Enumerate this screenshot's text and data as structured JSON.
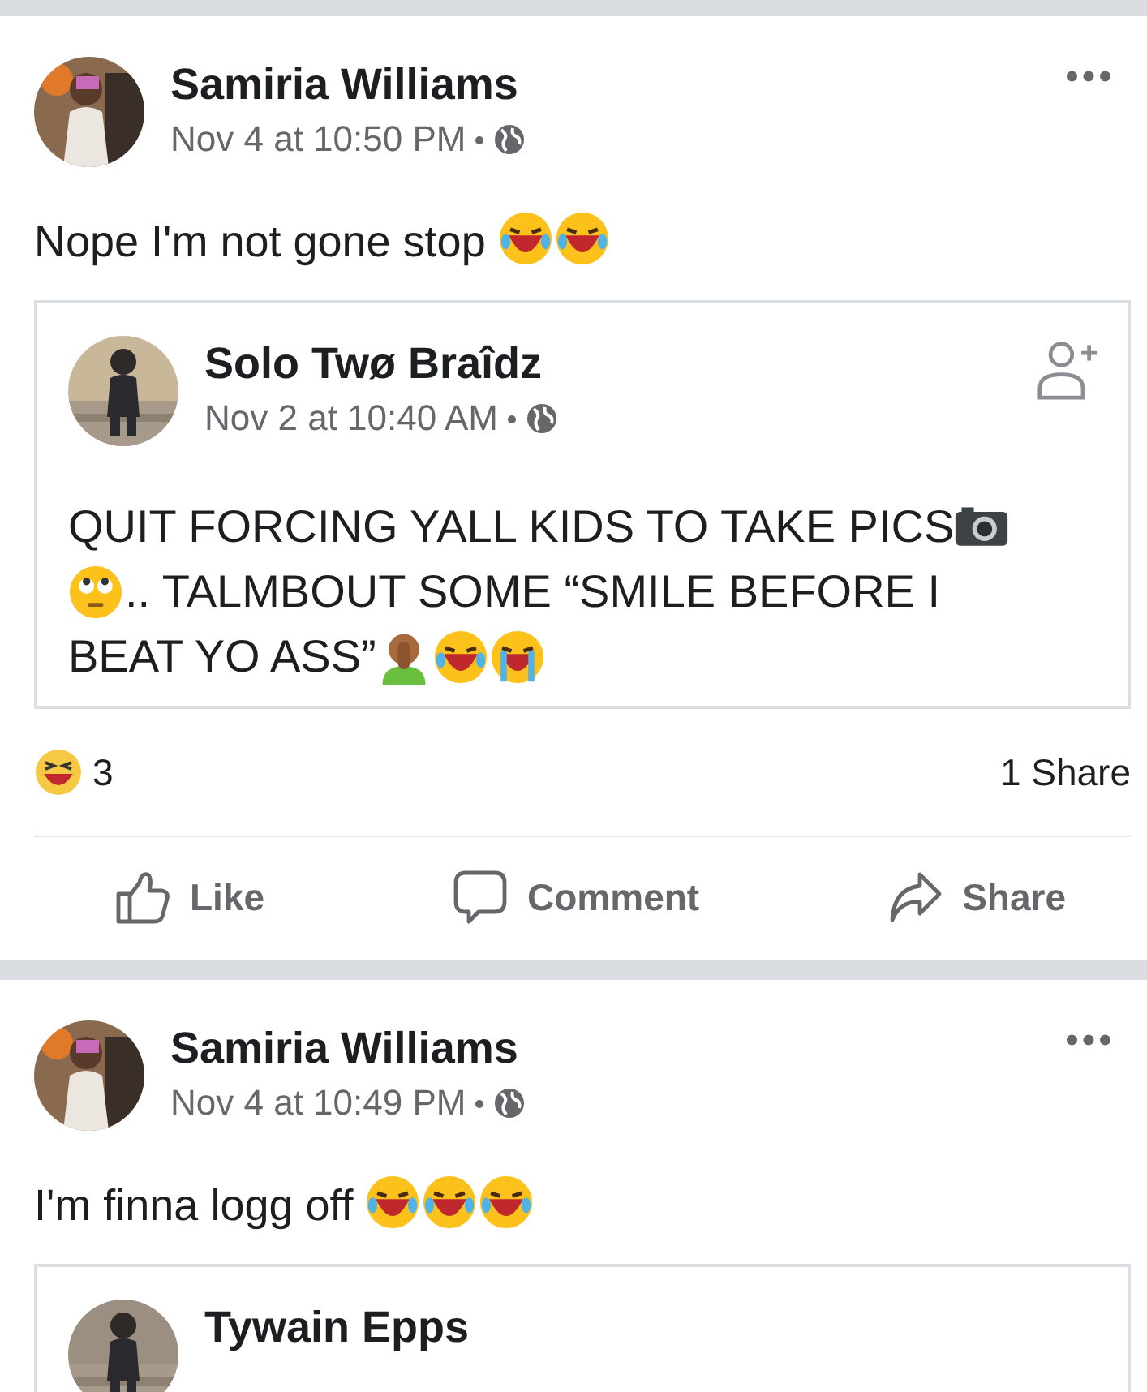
{
  "posts": [
    {
      "author": "Samiria Williams",
      "time": "Nov 4 at 10:50 PM",
      "body": [
        {
          "kind": "text",
          "text": "Nope I'm not gone stop "
        },
        {
          "kind": "tears-of-joy"
        },
        {
          "kind": "tears-of-joy"
        }
      ],
      "shared": {
        "author": "Solo Twø Braîdz",
        "time": "Nov 2 at 10:40 AM",
        "lines": [
          [
            {
              "kind": "text",
              "text": "QUIT FORCING YALL KIDS TO TAKE PICS"
            },
            {
              "kind": "camera"
            }
          ],
          [
            {
              "kind": "eye-roll"
            },
            {
              "kind": "text",
              "text": ".. TALMBOUT SOME “SMILE BEFORE I"
            }
          ],
          [
            {
              "kind": "text",
              "text": "BEAT YO ASS”"
            },
            {
              "kind": "facepalm"
            },
            {
              "kind": "rofl"
            },
            {
              "kind": "crying"
            }
          ]
        ]
      },
      "reactions": {
        "count": "3"
      },
      "shares": "1 Share",
      "actions": [
        {
          "kind": "like",
          "label": "Like"
        },
        {
          "kind": "comment",
          "label": "Comment"
        },
        {
          "kind": "share",
          "label": "Share"
        }
      ]
    },
    {
      "author": "Samiria Williams",
      "time": "Nov 4 at 10:49 PM",
      "body": [
        {
          "kind": "text",
          "text": "I'm finna logg off "
        },
        {
          "kind": "rofl"
        },
        {
          "kind": "rofl"
        },
        {
          "kind": "rofl"
        }
      ],
      "shared": {
        "author": "Tywain Epps"
      }
    }
  ]
}
